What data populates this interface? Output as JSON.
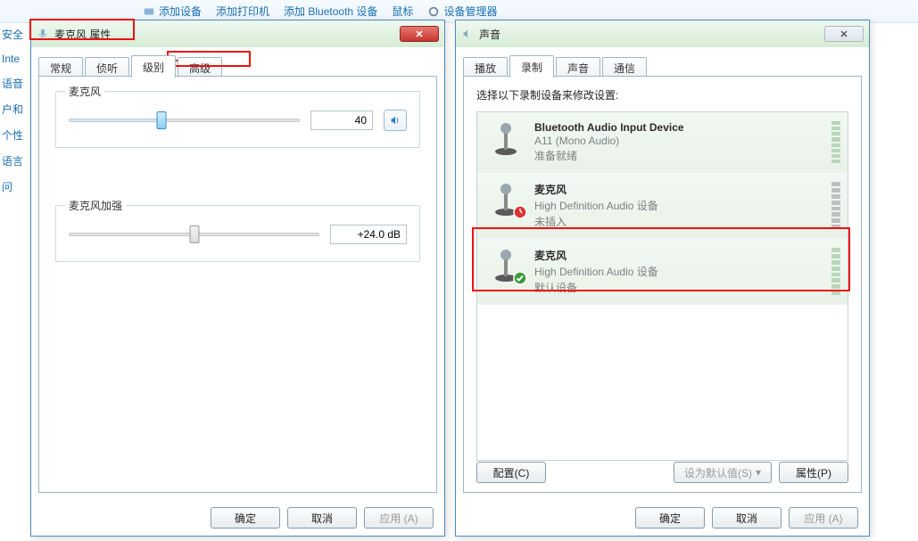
{
  "cp_links": {
    "add_device": "添加设备",
    "add_printer": "添加打印机",
    "add_bluetooth": "添加 Bluetooth 设备",
    "mouse": "鼠标",
    "device_manager": "设备管理器"
  },
  "side_labels": [
    "安全",
    "Inte",
    "语音",
    "户和",
    "个性",
    "语言",
    "问"
  ],
  "mic_dialog": {
    "title": "麦克风 属性",
    "tabs": {
      "general": "常规",
      "listen": "侦听",
      "levels": "级别",
      "advanced": "高级"
    },
    "active_tab": "levels",
    "group_mic": {
      "label": "麦克风",
      "value": "40",
      "pct": 40,
      "speaker_title": "音量"
    },
    "group_boost": {
      "label": "麦克风加强",
      "value": "+24.0 dB",
      "pct": 50
    },
    "buttons": {
      "ok": "确定",
      "cancel": "取消",
      "apply": "应用 (A)"
    }
  },
  "sound_dialog": {
    "title": "声音",
    "tabs": {
      "playback": "播放",
      "recording": "录制",
      "sounds": "声音",
      "communications": "通信"
    },
    "active_tab": "recording",
    "hint": "选择以下录制设备来修改设置:",
    "devices": [
      {
        "name": "Bluetooth Audio Input Device",
        "sub1": "A11 (Mono Audio)",
        "sub2": "准备就绪",
        "status": "ready"
      },
      {
        "name": "麦克风",
        "sub1": "High Definition Audio 设备",
        "sub2": "未插入",
        "status": "unplugged"
      },
      {
        "name": "麦克风",
        "sub1": "High Definition Audio 设备",
        "sub2": "默认设备",
        "status": "default"
      }
    ],
    "buttons": {
      "configure": "配置(C)",
      "set_default": "设为默认值(S)",
      "properties": "属性(P)",
      "ok": "确定",
      "cancel": "取消",
      "apply": "应用 (A)"
    }
  }
}
